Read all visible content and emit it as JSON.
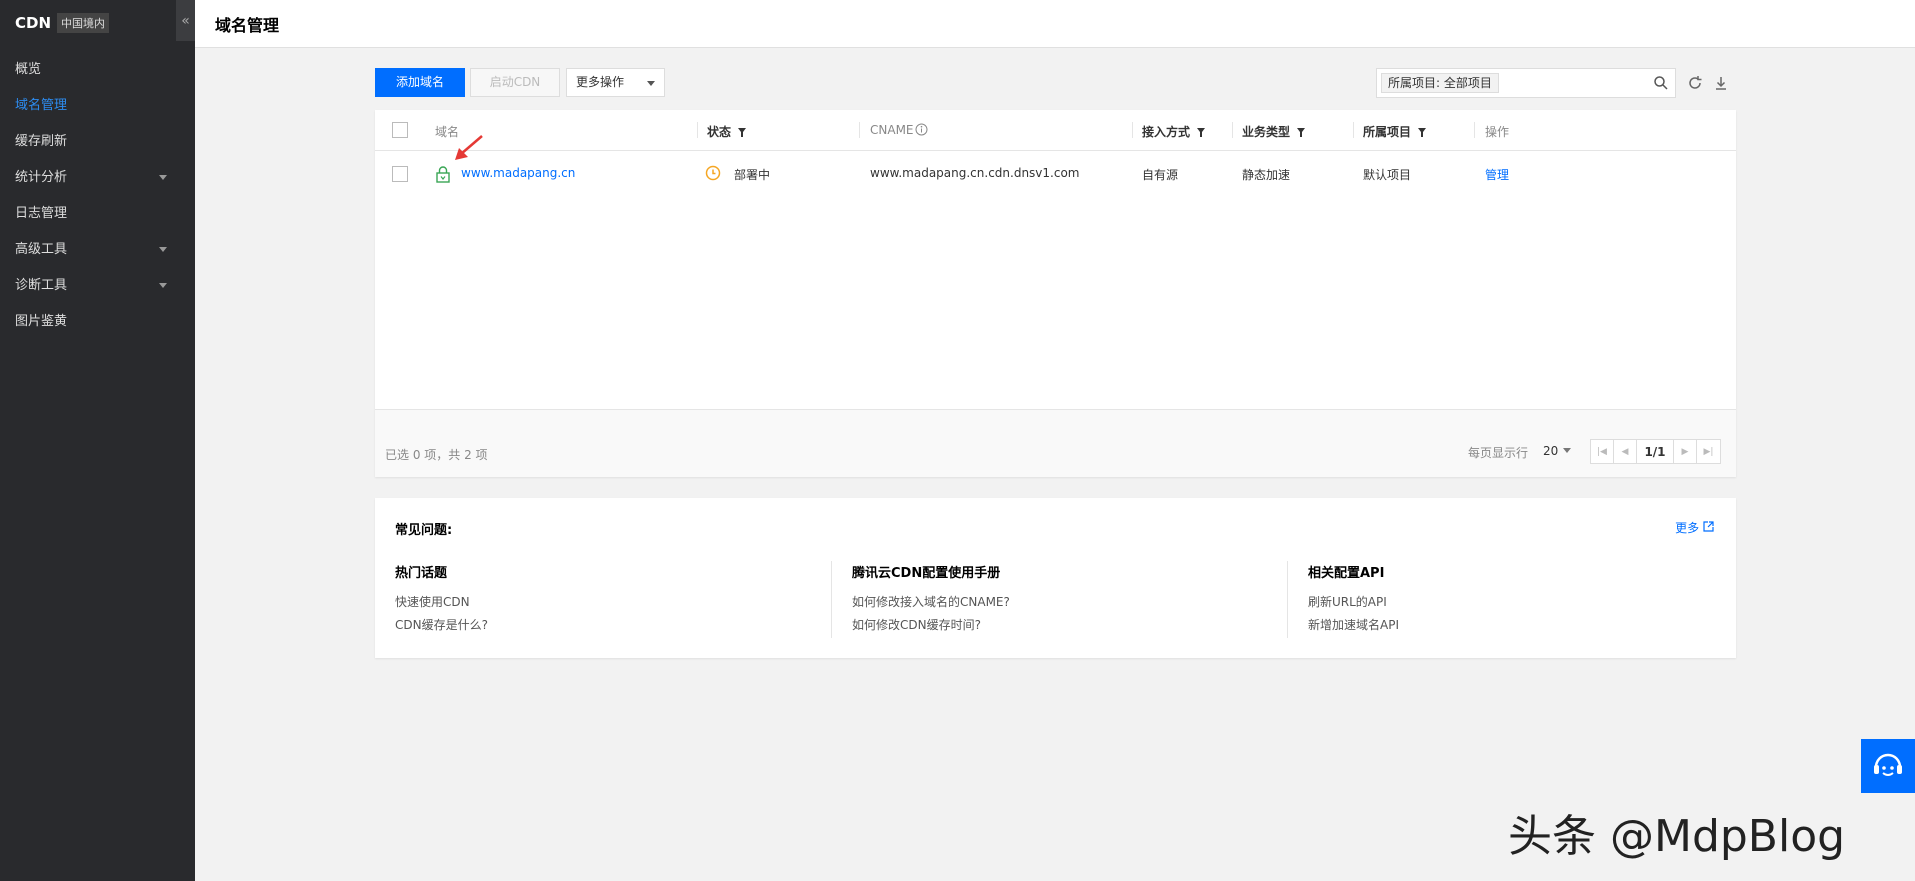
{
  "sidebar": {
    "title": "CDN",
    "region": "中国境内",
    "collapse": "«",
    "items": [
      {
        "label": "概览"
      },
      {
        "label": "域名管理"
      },
      {
        "label": "缓存刷新"
      },
      {
        "label": "统计分析"
      },
      {
        "label": "日志管理"
      },
      {
        "label": "高级工具"
      },
      {
        "label": "诊断工具"
      },
      {
        "label": "图片鉴黄"
      }
    ]
  },
  "header": {
    "title": "域名管理"
  },
  "toolbar": {
    "add_label": "添加域名",
    "enable_label": "启动CDN",
    "more_label": "更多操作",
    "search_tag": "所属项目: 全部项目"
  },
  "table": {
    "columns": [
      "域名",
      "状态",
      "CNAME",
      "接入方式",
      "业务类型",
      "所属项目",
      "操作"
    ],
    "rows": [
      {
        "domain": "www.madapang.cn",
        "status": "部署中",
        "cname": "www.madapang.cn.cdn.dnsv1.com",
        "access": "自有源",
        "service": "静态加速",
        "project": "默认项目",
        "action": "管理"
      }
    ],
    "summary": "已选 0 项，共 2 项",
    "page_size_label": "每页显示行",
    "page_size": "20",
    "page": "1/1"
  },
  "faq": {
    "title": "常见问题:",
    "more": "更多",
    "columns": [
      {
        "heading": "热门话题",
        "links": [
          "快速使用CDN",
          "CDN缓存是什么?"
        ]
      },
      {
        "heading": "腾讯云CDN配置使用手册",
        "links": [
          "如何修改接入域名的CNAME?",
          "如何修改CDN缓存时间?"
        ]
      },
      {
        "heading": "相关配置API",
        "links": [
          "刷新URL的API",
          "新增加速域名API"
        ]
      }
    ]
  },
  "watermark": "头条 @MdpBlog",
  "colors": {
    "accent": "#006eff",
    "sidebar_bg": "#292a2d",
    "active_nav": "#2d8cf0",
    "status_warning": "#f5a623",
    "secure_icon": "#3aa655",
    "arrow": "#e53935"
  }
}
